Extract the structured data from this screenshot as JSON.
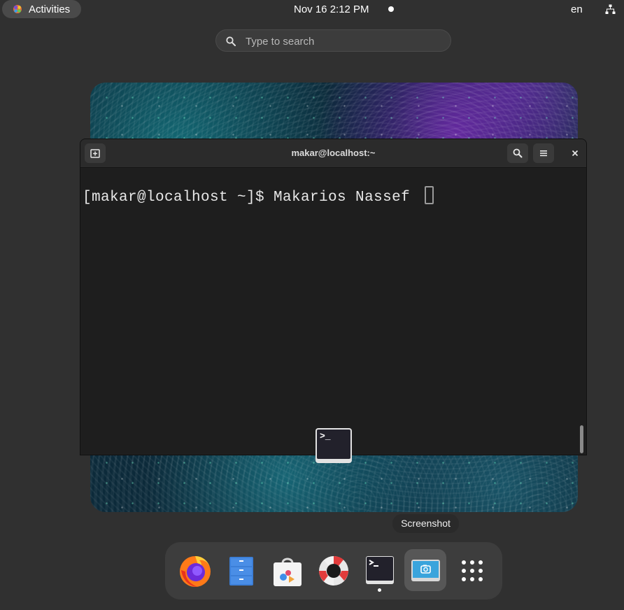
{
  "topbar": {
    "activities_label": "Activities",
    "clock": "Nov 16   2:12 PM",
    "language": "en"
  },
  "search": {
    "placeholder": "Type to search"
  },
  "terminal": {
    "title": "makar@localhost:~",
    "prompt_line": "[makar@localhost ~]$ Makarios Nassef ",
    "app_icon_prompt": ">_"
  },
  "tooltip": {
    "text": "Screenshot"
  },
  "dock": {
    "items": [
      {
        "name": "Firefox",
        "icon": "firefox-icon"
      },
      {
        "name": "Files",
        "icon": "files-icon"
      },
      {
        "name": "Software",
        "icon": "software-icon"
      },
      {
        "name": "Help",
        "icon": "help-icon"
      },
      {
        "name": "Terminal",
        "icon": "terminal-icon",
        "running": true
      },
      {
        "name": "Screenshot",
        "icon": "screenshot-icon",
        "active": true
      },
      {
        "name": "Show Applications",
        "icon": "app-grid-icon"
      }
    ]
  },
  "colors": {
    "panel": "#303030",
    "dock": "#3d3d3d",
    "terminal_bg": "#1e1e1e",
    "terminal_header": "#2b2b2b"
  }
}
